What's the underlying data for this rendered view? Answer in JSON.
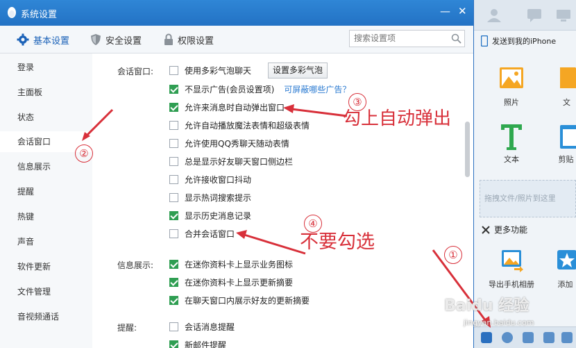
{
  "window": {
    "title": "系统设置"
  },
  "toolbar": {
    "tabs": [
      {
        "label": "基本设置",
        "icon": "gear-icon"
      },
      {
        "label": "安全设置",
        "icon": "shield-icon"
      },
      {
        "label": "权限设置",
        "icon": "lock-icon"
      }
    ],
    "search_placeholder": "搜索设置项"
  },
  "sidebar": {
    "items": [
      "登录",
      "主面板",
      "状态",
      "会话窗口",
      "信息展示",
      "提醒",
      "热键",
      "声音",
      "软件更新",
      "文件管理",
      "音视频通话"
    ],
    "active_index": 3
  },
  "content": {
    "session_label": "会话窗口:",
    "options_session": [
      {
        "label": "使用多彩气泡聊天",
        "checked": false
      },
      {
        "label": "不显示广告(会员设置项)",
        "checked": true
      },
      {
        "label": "允许来消息时自动弹出窗口",
        "checked": true
      },
      {
        "label": "允许自动播放魔法表情和超级表情",
        "checked": false
      },
      {
        "label": "允许使用QQ秀聊天随动表情",
        "checked": false
      },
      {
        "label": "总是显示好友聊天窗口侧边栏",
        "checked": false
      },
      {
        "label": "允许接收窗口抖动",
        "checked": false
      },
      {
        "label": "显示热词搜索提示",
        "checked": false
      },
      {
        "label": "显示历史消息记录",
        "checked": true
      },
      {
        "label": "合并会话窗口",
        "checked": false
      }
    ],
    "bubble_button": "设置多彩气泡",
    "ads_link": "可屏蔽哪些广告？",
    "info_label": "信息展示:",
    "options_info": [
      {
        "label": "在迷你资料卡上显示业务图标",
        "checked": true
      },
      {
        "label": "在迷你资料卡上显示更新摘要",
        "checked": true
      },
      {
        "label": "在聊天窗口内展示好友的更新摘要",
        "checked": true
      }
    ],
    "remind_label": "提醒:",
    "options_remind": [
      {
        "label": "会话消息提醒",
        "checked": false
      },
      {
        "label": "新邮件提醒",
        "checked": true
      }
    ]
  },
  "annotations": {
    "n1": "①",
    "n2": "②",
    "n3": "③",
    "n4": "④",
    "text3": "勾上自动弹出",
    "text4": "不要勾选"
  },
  "rpanel": {
    "send_to": "发送到我的iPhone",
    "tiles": [
      {
        "label": "照片",
        "icon": "photo-icon"
      },
      {
        "label": "文",
        "icon": "file-icon"
      },
      {
        "label": "文本",
        "icon": "text-icon"
      },
      {
        "label": "剪贴",
        "icon": "clipboard-icon"
      }
    ],
    "drop_hint": "拖拽文件/照片到这里",
    "more_label": "更多功能",
    "more_tiles": [
      {
        "label": "导出手机相册",
        "icon": "export-album-icon"
      },
      {
        "label": "添加",
        "icon": "star-icon"
      }
    ]
  },
  "watermark": {
    "main": "Baidu 经验",
    "sub": "jingyan.baidu.com"
  },
  "colors": {
    "accent": "#2372c4",
    "check": "#2f9e52",
    "annotation": "#d8303a",
    "link": "#2a7ad1"
  }
}
